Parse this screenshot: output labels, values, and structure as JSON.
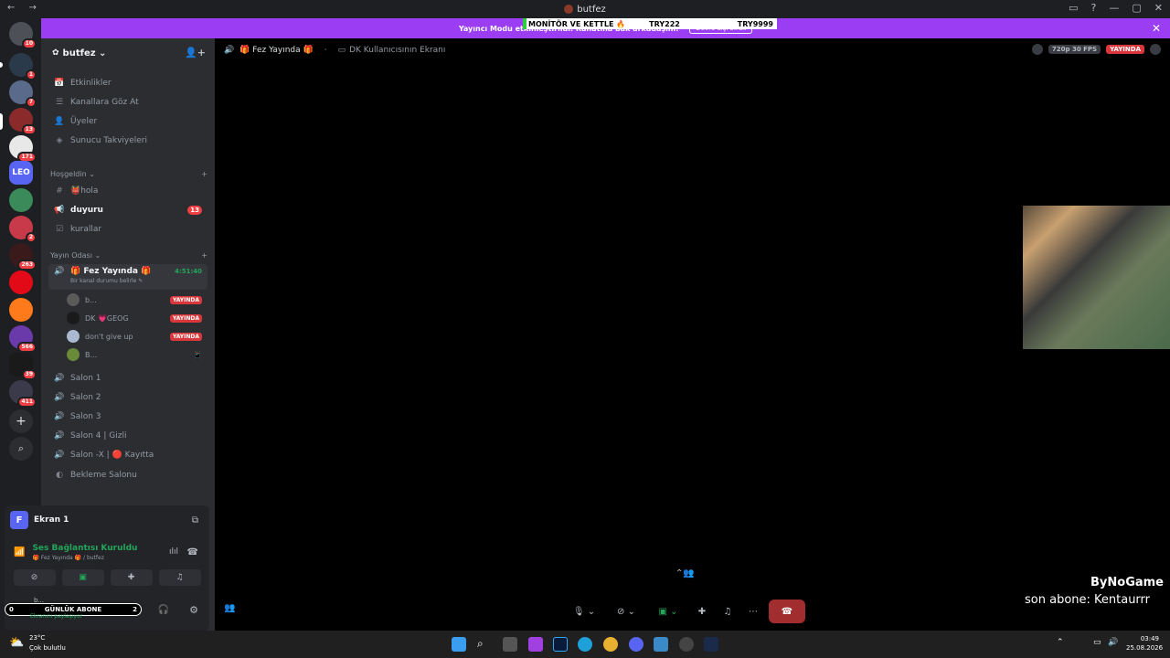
{
  "window": {
    "title": "butfez",
    "nav": "← →",
    "controls": [
      "▭",
      "?",
      "—",
      "▢",
      "✕"
    ]
  },
  "banner": {
    "text": "Yayıncı Modu etkinleştirildi. Rahatına bak arkadaşım.",
    "button": "Devre dışı bırak",
    "close": "✕"
  },
  "overlay": {
    "title": "MONİTÖR VE KETTLE 🔥",
    "mid": "TRY222",
    "right": "TRY9999"
  },
  "rail": {
    "servers": [
      {
        "badge": "10"
      },
      {
        "badge": "1"
      },
      {
        "badge": "7"
      },
      {
        "badge": "13"
      },
      {
        "badge": "171"
      },
      {
        "badge": ""
      },
      {
        "badge": ""
      },
      {
        "badge": "2"
      },
      {
        "badge": "263"
      },
      {
        "badge": ""
      },
      {
        "badge": ""
      },
      {
        "badge": "566"
      },
      {
        "badge": "39"
      },
      {
        "badge": "411"
      }
    ],
    "add": "+",
    "explore": "⌕",
    "leo_label": "LEO"
  },
  "server": {
    "name": "butfez ⌄"
  },
  "nav_items": [
    {
      "label": "Etkinlikler",
      "icon": "📅"
    },
    {
      "label": "Kanallara Göz At",
      "icon": "☰"
    },
    {
      "label": "Üyeler",
      "icon": "👤"
    },
    {
      "label": "Sunucu Takviyeleri",
      "icon": "◈"
    }
  ],
  "categories": {
    "welcome": "Hoşgeldin ⌄",
    "stream": "Yayın Odası ⌄",
    "add": "+"
  },
  "channels": {
    "hola": "👹hola",
    "duyuru": "duyuru",
    "duyuru_count": "13",
    "kurallar": "kurallar",
    "fez": "🎁 Fez Yayında 🎁",
    "fez_status": "Bir kanal durumu belirle ✎",
    "fez_timer": "4:51:40",
    "salon1": "Salon 1",
    "salon2": "Salon 2",
    "salon3": "Salon 3",
    "salon4": "Salon 4 | Gizli",
    "salonx": "Salon -X | 🔴 Kayıtta",
    "bekleme": "Bekleme Salonu"
  },
  "voice_users": [
    {
      "name": "b...",
      "live": "YAYINDA"
    },
    {
      "name": "DK 💗GEOG",
      "live": "YAYINDA"
    },
    {
      "name": "don't give up",
      "live": "YAYINDA"
    },
    {
      "name": "B...",
      "live": ""
    }
  ],
  "panel": {
    "screen_avatar": "F",
    "screen_name": "Ekran 1",
    "voice_status": "Ses Bağlantısı Kuruldu",
    "voice_channel": "🎁 Fez Yayında 🎁 / butfez",
    "sub_goal": "GÜNLÜK ABONE",
    "sub_left": "0",
    "sub_right": "2",
    "user_name": "b...",
    "user_status": "Ekranını paylaşıyor"
  },
  "main": {
    "stream_title": "🎁 Fez Yayında 🎁",
    "screen_share": "DK Kullanıcısının Ekranı",
    "quality": "720p 30 FPS",
    "live": "YAYINDA"
  },
  "stream_overlay": {
    "brand": "ByNoGame",
    "ticker": "son abone: Kentaurrr"
  },
  "taskbar": {
    "temp": "23°C",
    "weather": "Çok bulutlu",
    "time": "03:49",
    "date": "25.08.2026"
  },
  "colors": {
    "accent": "#9b3df2",
    "live": "#da373c",
    "green": "#23a55a",
    "badge": "#f23f43"
  }
}
